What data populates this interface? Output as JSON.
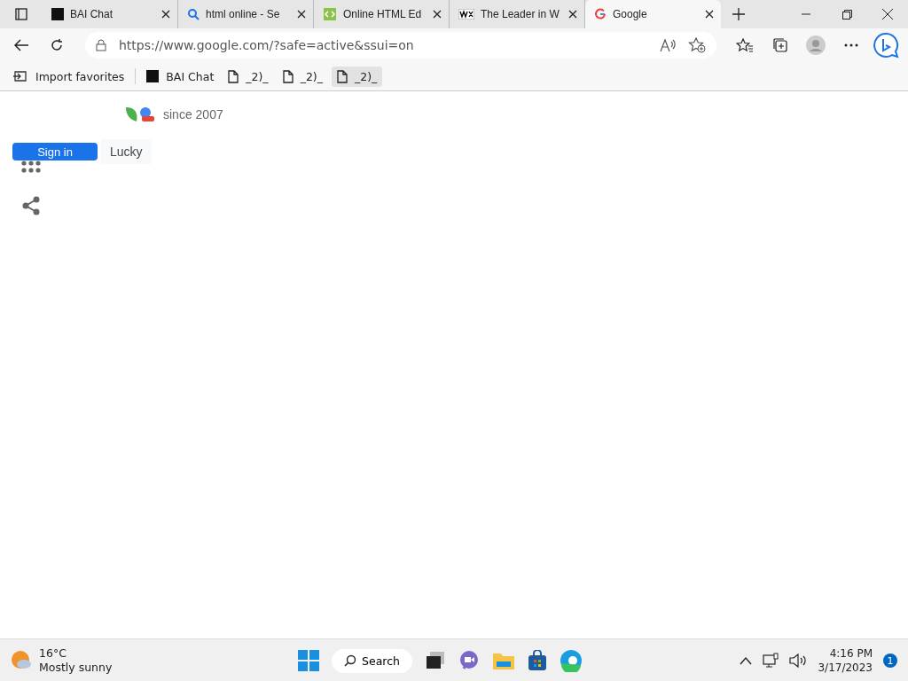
{
  "tabs": [
    {
      "title": "BAI Chat",
      "selected": false
    },
    {
      "title": "html online - Se",
      "selected": false
    },
    {
      "title": "Online HTML Ed",
      "selected": false
    },
    {
      "title": "The Leader in W",
      "selected": false
    },
    {
      "title": "Google",
      "selected": true
    }
  ],
  "address_bar": {
    "url": "https://www.google.com/?safe=active&ssui=on"
  },
  "favorites_bar": [
    {
      "label": "Import favorites",
      "hovered": false
    },
    {
      "label": "BAI Chat",
      "hovered": false
    },
    {
      "label": "_2)_",
      "hovered": false
    },
    {
      "label": "_2)_",
      "hovered": false
    },
    {
      "label": "_2)_",
      "hovered": true
    }
  ],
  "page": {
    "tagline": "since 2007",
    "sign_in": "Sign in",
    "lucky": "Lucky"
  },
  "taskbar": {
    "temperature": "16°C",
    "weather": "Mostly sunny",
    "search": "Search",
    "time": "4:16 PM",
    "date": "3/17/2023",
    "notifications": "1"
  }
}
